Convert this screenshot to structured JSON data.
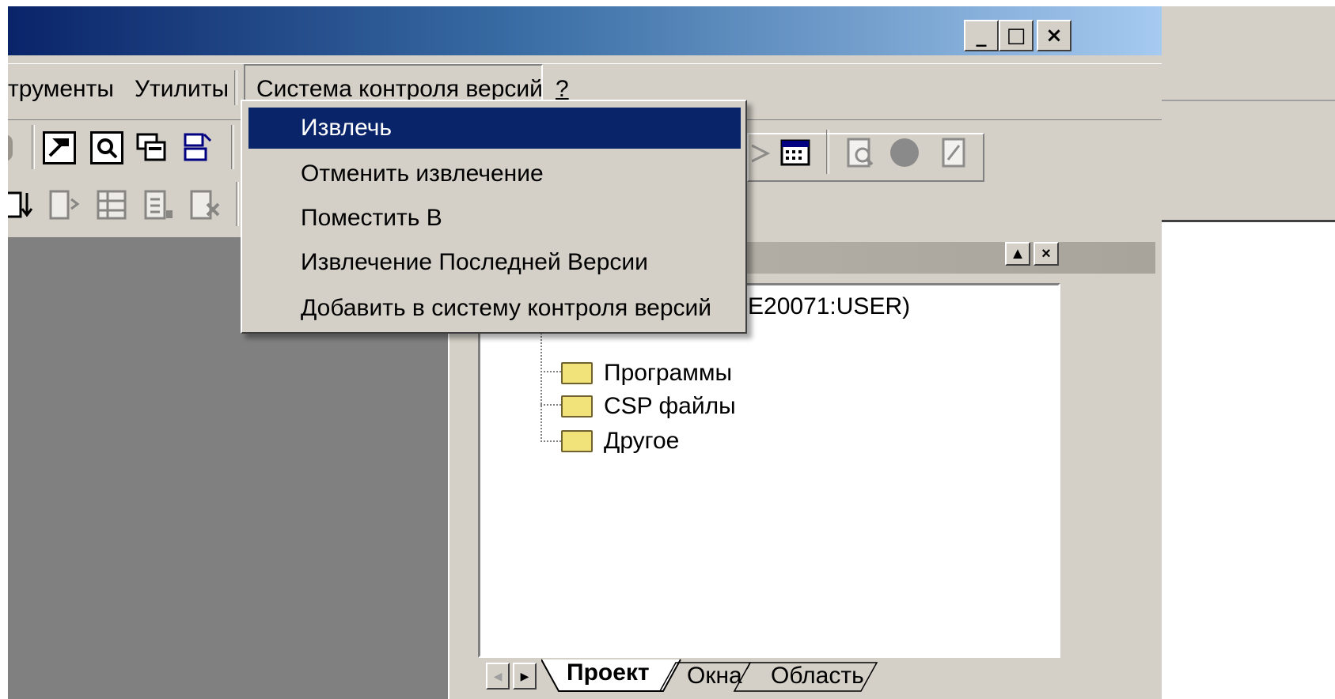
{
  "window": {
    "controls": {
      "minimize": "_",
      "maximize": "□",
      "close": "×"
    }
  },
  "menu": {
    "items": [
      {
        "label": "трументы"
      },
      {
        "label": "Утилиты"
      },
      {
        "label": "Система контроля версий"
      },
      {
        "label": "?"
      }
    ]
  },
  "dropdown": {
    "items": [
      {
        "label": "Извлечь",
        "selected": true
      },
      {
        "label": "Отменить извлечение"
      },
      {
        "label": "Поместить В"
      },
      {
        "label": "Извлечение Последней Версии"
      },
      {
        "label": "Добавить в систему контроля версий"
      }
    ]
  },
  "workspace": {
    "tree": {
      "root_partial": "E20071:USER)",
      "children": [
        {
          "label": "Программы",
          "icon": "folder-icon"
        },
        {
          "label": "CSP файлы",
          "icon": "folder-icon"
        },
        {
          "label": "Другое",
          "icon": "folder-icon"
        }
      ]
    },
    "tabs": [
      {
        "label": "Проект",
        "active": true
      },
      {
        "label": "Окна"
      },
      {
        "label": "Область"
      }
    ]
  },
  "colors": {
    "selection": "#0a246a",
    "face": "#d4d0c8",
    "mdi_background": "#808080",
    "titlebar_start": "#0a246a",
    "titlebar_end": "#a6caf0"
  }
}
